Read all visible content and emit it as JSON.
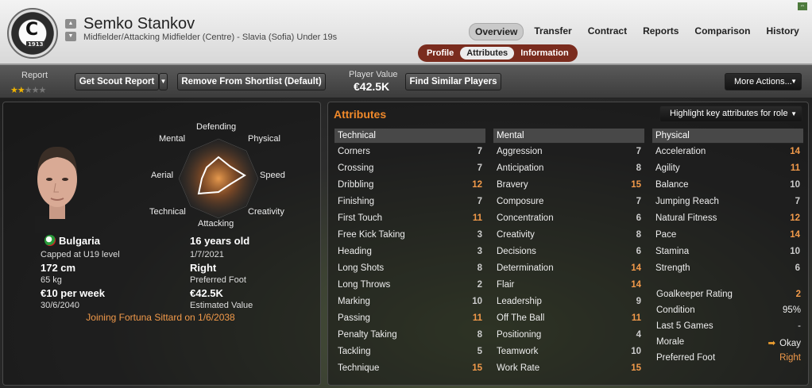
{
  "player": {
    "name": "Semko Stankov",
    "subtitle": "Midfielder/Attacking Midfielder (Centre) - Slavia (Sofia) Under 19s",
    "crest_letter": "С",
    "crest_year": "1913"
  },
  "nav": {
    "tabs": [
      "Overview",
      "Transfer",
      "Contract",
      "Reports",
      "Comparison",
      "History"
    ],
    "active_tab": "Overview",
    "subtabs": [
      "Profile",
      "Attributes",
      "Information"
    ],
    "active_subtab": "Attributes"
  },
  "toolbar": {
    "report_label": "Report",
    "report_stars": 2,
    "report_max_stars": 5,
    "get_scout_report": "Get Scout Report",
    "remove_shortlist": "Remove From Shortlist (Default)",
    "player_value_label": "Player Value",
    "player_value": "€42.5K",
    "find_similar": "Find Similar Players",
    "more_actions": "More Actions..."
  },
  "profile": {
    "nationality": "Bulgaria",
    "caps": "Capped at U19 level",
    "height": "172 cm",
    "weight": "65 kg",
    "wage": "€10 per week",
    "contract_end": "30/6/2040",
    "age": "16 years old",
    "dob": "1/7/2021",
    "foot": "Right",
    "foot_label": "Preferred Foot",
    "value": "€42.5K",
    "value_label": "Estimated Value",
    "joining": "Joining Fortuna Sittard on 1/6/2038"
  },
  "radar": {
    "labels": {
      "defending": "Defending",
      "physical": "Physical",
      "speed": "Speed",
      "creativity": "Creativity",
      "attacking": "Attacking",
      "technical": "Technical",
      "aerial": "Aerial",
      "mental": "Mental"
    }
  },
  "attributes": {
    "title": "Attributes",
    "highlight_label": "Highlight key attributes for role",
    "technical": {
      "title": "Technical",
      "items": [
        {
          "name": "Corners",
          "value": "7"
        },
        {
          "name": "Crossing",
          "value": "7"
        },
        {
          "name": "Dribbling",
          "value": "12"
        },
        {
          "name": "Finishing",
          "value": "7"
        },
        {
          "name": "First Touch",
          "value": "11"
        },
        {
          "name": "Free Kick Taking",
          "value": "3"
        },
        {
          "name": "Heading",
          "value": "3"
        },
        {
          "name": "Long Shots",
          "value": "8"
        },
        {
          "name": "Long Throws",
          "value": "2"
        },
        {
          "name": "Marking",
          "value": "10"
        },
        {
          "name": "Passing",
          "value": "11"
        },
        {
          "name": "Penalty Taking",
          "value": "8"
        },
        {
          "name": "Tackling",
          "value": "5"
        },
        {
          "name": "Technique",
          "value": "15"
        }
      ]
    },
    "mental": {
      "title": "Mental",
      "items": [
        {
          "name": "Aggression",
          "value": "7"
        },
        {
          "name": "Anticipation",
          "value": "8"
        },
        {
          "name": "Bravery",
          "value": "15"
        },
        {
          "name": "Composure",
          "value": "7"
        },
        {
          "name": "Concentration",
          "value": "6"
        },
        {
          "name": "Creativity",
          "value": "8"
        },
        {
          "name": "Decisions",
          "value": "6"
        },
        {
          "name": "Determination",
          "value": "14"
        },
        {
          "name": "Flair",
          "value": "14"
        },
        {
          "name": "Leadership",
          "value": "9"
        },
        {
          "name": "Off The Ball",
          "value": "11"
        },
        {
          "name": "Positioning",
          "value": "4"
        },
        {
          "name": "Teamwork",
          "value": "10"
        },
        {
          "name": "Work Rate",
          "value": "15"
        }
      ]
    },
    "physical": {
      "title": "Physical",
      "items": [
        {
          "name": "Acceleration",
          "value": "14"
        },
        {
          "name": "Agility",
          "value": "11"
        },
        {
          "name": "Balance",
          "value": "10"
        },
        {
          "name": "Jumping Reach",
          "value": "7"
        },
        {
          "name": "Natural Fitness",
          "value": "12"
        },
        {
          "name": "Pace",
          "value": "14"
        },
        {
          "name": "Stamina",
          "value": "10"
        },
        {
          "name": "Strength",
          "value": "6"
        }
      ]
    },
    "extras": [
      {
        "name": "Goalkeeper Rating",
        "value": "2"
      },
      {
        "name": "Condition",
        "value": "95%"
      },
      {
        "name": "Last 5 Games",
        "value": "-"
      },
      {
        "name": "Morale",
        "value": "Okay"
      },
      {
        "name": "Preferred Foot",
        "value": "Right"
      }
    ]
  },
  "colors": {
    "accent": "#f29a4a",
    "subtab_bar": "#7a2c1e",
    "star": "#f0b400"
  }
}
